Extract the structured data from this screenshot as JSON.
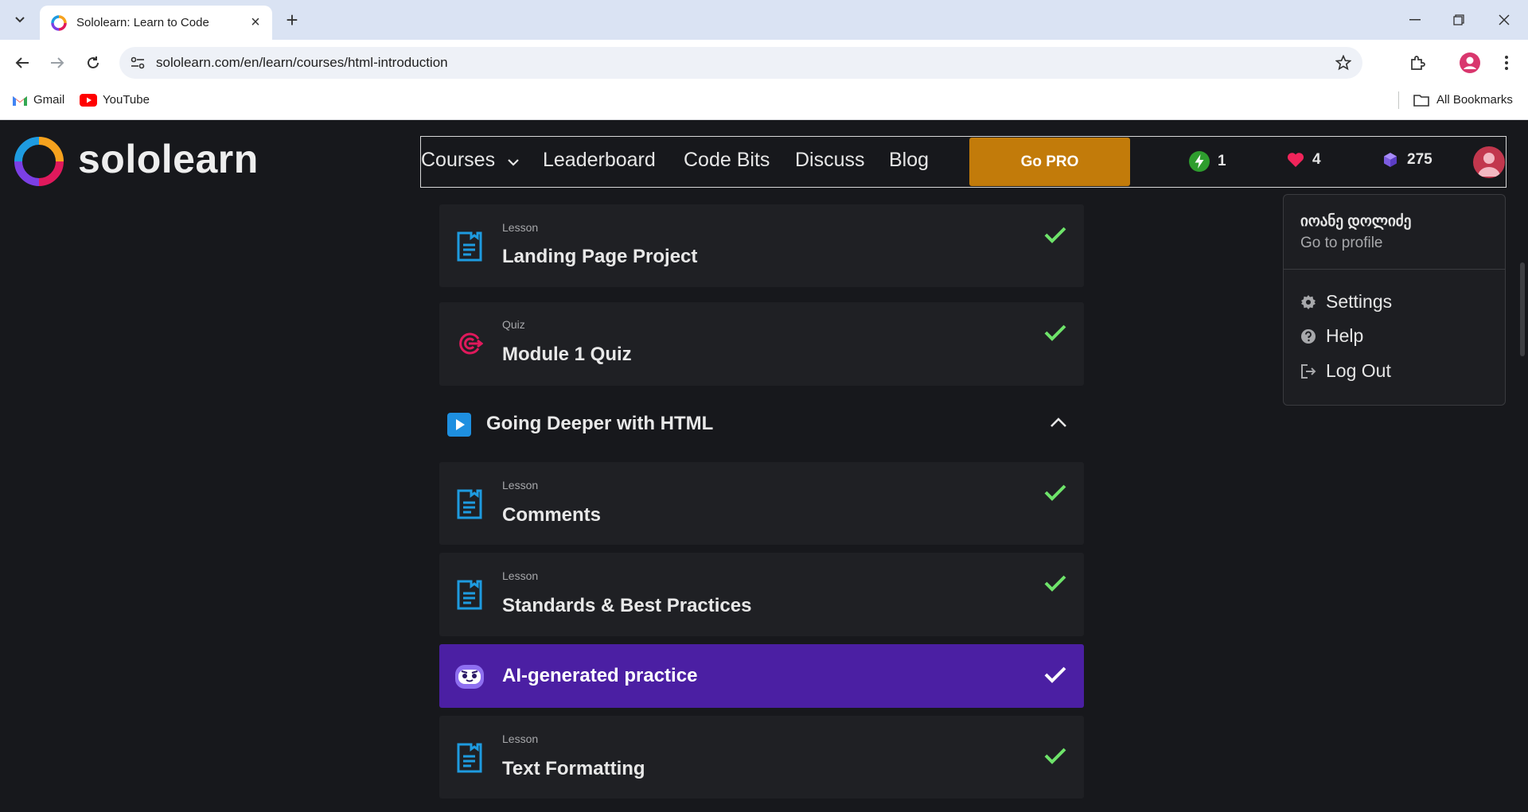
{
  "browser": {
    "tab_title": "Sololearn: Learn to Code",
    "url": "sololearn.com/en/learn/courses/html-introduction",
    "bookmarks": [
      {
        "label": "Gmail",
        "icon": "gmail-icon"
      },
      {
        "label": "YouTube",
        "icon": "youtube-icon"
      }
    ],
    "all_bookmarks_label": "All Bookmarks"
  },
  "header": {
    "logo_text": "sololearn",
    "nav": {
      "courses": "Courses",
      "leaderboard": "Leaderboard",
      "code_bits": "Code Bits",
      "discuss": "Discuss",
      "blog": "Blog"
    },
    "go_pro": "Go PRO",
    "stats": {
      "streak": "1",
      "hearts": "4",
      "bits": "275"
    }
  },
  "course": {
    "items_top": [
      {
        "kind": "Lesson",
        "title": "Landing Page Project",
        "icon": "lesson-icon",
        "completed": true
      },
      {
        "kind": "Quiz",
        "title": "Module 1 Quiz",
        "icon": "quiz-target-icon",
        "completed": true
      }
    ],
    "section": {
      "title": "Going Deeper with HTML",
      "expanded": true
    },
    "items_section": [
      {
        "kind": "Lesson",
        "title": "Comments",
        "icon": "lesson-icon",
        "completed": true
      },
      {
        "kind": "Lesson",
        "title": "Standards & Best Practices",
        "icon": "lesson-icon",
        "completed": true
      }
    ],
    "ai_practice": {
      "title": "AI-generated practice",
      "completed": true
    },
    "items_after": [
      {
        "kind": "Lesson",
        "title": "Text Formatting",
        "icon": "lesson-icon",
        "completed": true
      }
    ]
  },
  "profile_menu": {
    "name": "იოანე დოლიძე",
    "go_to_profile": "Go to profile",
    "items": [
      {
        "label": "Settings",
        "icon": "gear-icon"
      },
      {
        "label": "Help",
        "icon": "help-icon"
      },
      {
        "label": "Log Out",
        "icon": "logout-icon"
      }
    ]
  },
  "colors": {
    "page_bg": "#17181c",
    "card_bg": "#1f2024",
    "go_pro": "#c27b0a",
    "ai_card": "#4b1fa3",
    "check": "#6ee36a",
    "lesson_icon": "#1e9be0",
    "quiz_icon": "#e0195c"
  }
}
